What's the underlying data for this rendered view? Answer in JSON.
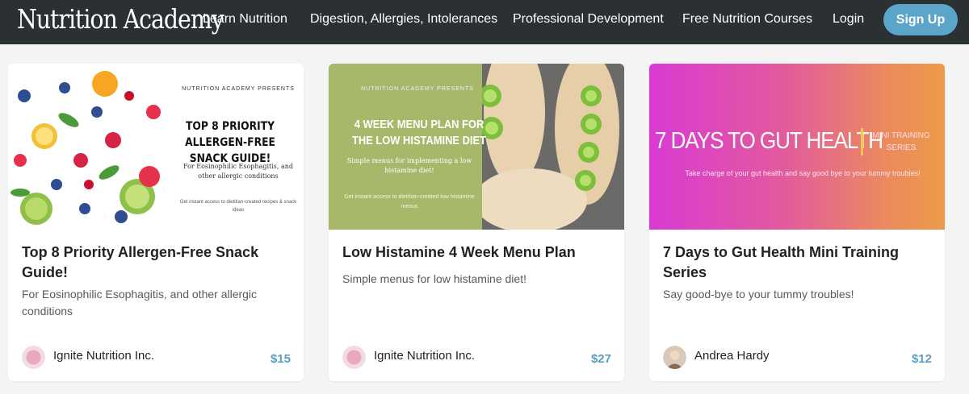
{
  "nav": {
    "brand": "Nutrition Academy",
    "links": [
      "Learn Nutrition",
      "Digestion, Allergies, Intolerances",
      "Professional Development",
      "Free Nutrition Courses",
      "Login"
    ],
    "signup": "Sign Up"
  },
  "cards": [
    {
      "thumb": {
        "presents": "NUTRITION ACADEMY PRESENTS",
        "headline": "TOP 8 PRIORITY ALLERGEN-FREE SNACK GUIDE!",
        "sub": "For Eosinophilic Esophagitis, and other allergic conditions",
        "foot": "Get instant access to dietitian-created recipes & snack ideas"
      },
      "title": "Top 8 Priority Allergen-Free Snack Guide!",
      "subtitle": "For Eosinophilic Esophagitis, and other allergic conditions",
      "author": "Ignite Nutrition Inc.",
      "price": "$15"
    },
    {
      "thumb": {
        "presents": "NUTRITION ACADEMY PRESENTS",
        "headline": "4 WEEK MENU PLAN FOR THE LOW HISTAMINE DIET",
        "sub": "Simple menus for implementing a low histamine diet!",
        "foot": "Get instant access to dietitian-created low histamine menus"
      },
      "title": "Low Histamine 4 Week Menu Plan",
      "subtitle": "Simple menus for low histamine diet!",
      "author": "Ignite Nutrition Inc.",
      "price": "$27"
    },
    {
      "thumb": {
        "headline": "7 DAYS TO GUT HEALTH",
        "mini": "MINI TRAINING SERIES",
        "tagline": "Take charge of your gut health and say good bye to your tummy troubles!"
      },
      "title": "7 Days to Gut Health Mini Training Series",
      "subtitle": "Say good-bye to your tummy troubles!",
      "author": "Andrea Hardy",
      "price": "$12"
    }
  ],
  "colors": {
    "nav_bg": "#2b3033",
    "accent": "#5aa5c9",
    "price": "#5a9ec2",
    "page_bg": "#f4f4f4"
  }
}
